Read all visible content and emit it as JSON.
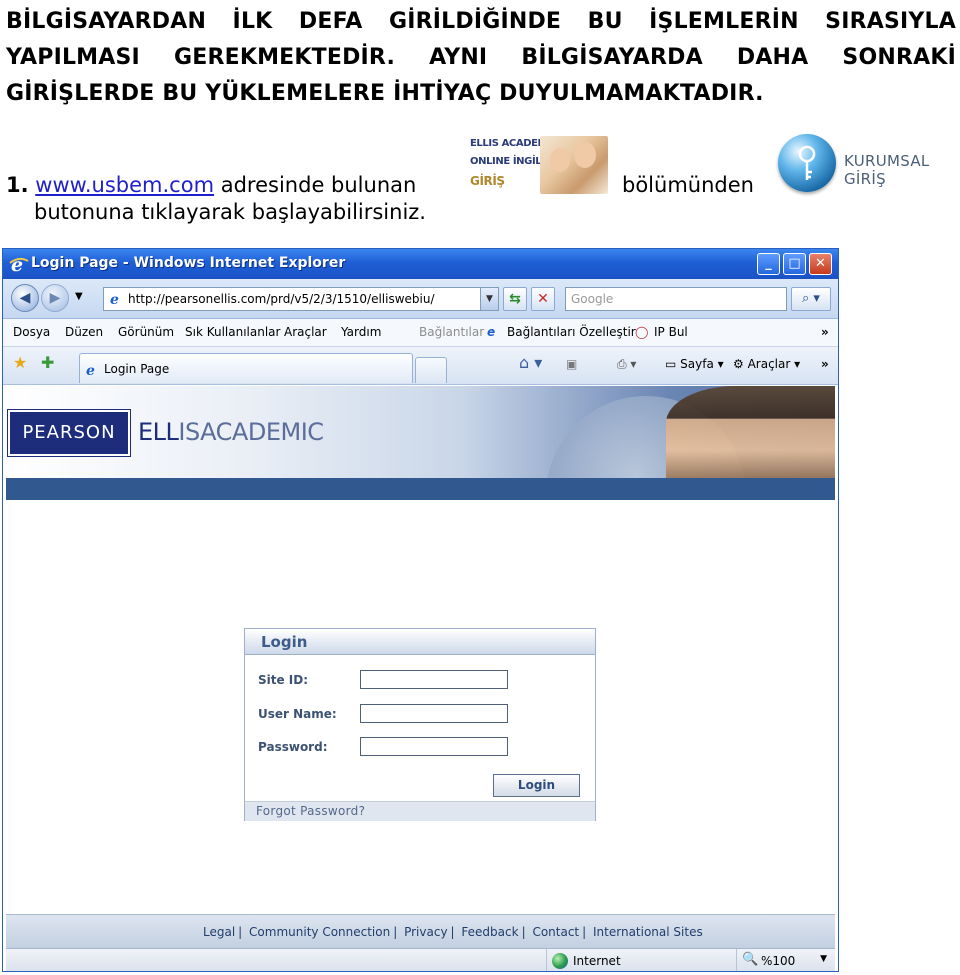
{
  "document": {
    "intro": "BİLGİSAYARDAN İLK DEFA GİRİLDİĞİNDE BU İŞLEMLERİN SIRASIYLA YAPILMASI GEREKMEKTEDİR. AYNI BİLGİSAYARDA DAHA SONRAKİ GİRİŞLERDE BU YÜKLEMELERE İHTİYAÇ DUYULMAMAKTADIR.",
    "step_number": "1.",
    "step_link": "www.usbem.com",
    "step_text_a": "adresinde bulunan",
    "step_text_b": "bölümünden",
    "step_text_c": "butonuna tıklayarak başlayabilirsiniz.",
    "ellis_logo": {
      "line1": "ELLIS ACADEMIC",
      "line2": "ONLINE İNGİLİZ",
      "line3": "GİRİŞ"
    },
    "kurumsal_logo": "KURUMSAL GİRİŞ"
  },
  "browser": {
    "window_title": "Login Page - Windows Internet Explorer",
    "url": "http://pearsonellis.com/prd/v5/2/3/1510/elliswebiu/",
    "search_placeholder": "Google",
    "menu": [
      "Dosya",
      "Düzen",
      "Görünüm",
      "Sık Kullanılanlar",
      "Araçlar",
      "Yardım"
    ],
    "links_label": "Bağlantılar",
    "custom_links": "Bağlantıları Özelleştir",
    "ip_bul": "IP Bul",
    "tab_title": "Login Page",
    "page_menu": "Sayfa",
    "tools_menu": "Araçlar",
    "status_zone": "Internet",
    "zoom": "%100"
  },
  "page": {
    "brand": "PEARSON",
    "product_bold": "ELL",
    "product_rest": "ISACADEMIC",
    "login": {
      "title": "Login",
      "site_id_label": "Site ID:",
      "user_name_label": "User Name:",
      "password_label": "Password:",
      "button": "Login",
      "forgot": "Forgot Password?"
    },
    "footer_links": [
      "Legal",
      "Community Connection",
      "Privacy",
      "Feedback",
      "Contact",
      "International Sites"
    ]
  },
  "colors": {
    "link": "#1f1fcc",
    "pearson_blue": "#1d2d7c",
    "xp_title": "#1f5fd6"
  }
}
